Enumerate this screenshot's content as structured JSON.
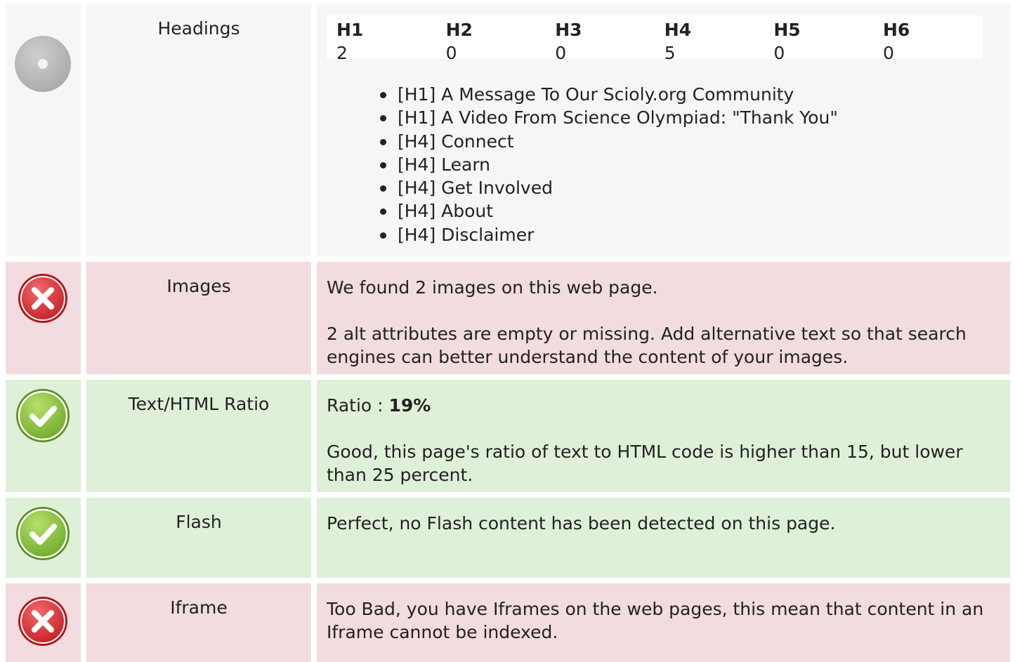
{
  "rows": {
    "headings": {
      "label": "Headings",
      "status": "neutral",
      "icon": "neutral-disc-icon",
      "table": [
        {
          "name": "H1",
          "count": "2"
        },
        {
          "name": "H2",
          "count": "0"
        },
        {
          "name": "H3",
          "count": "0"
        },
        {
          "name": "H4",
          "count": "5"
        },
        {
          "name": "H5",
          "count": "0"
        },
        {
          "name": "H6",
          "count": "0"
        }
      ],
      "list": [
        "[H1] A Message To Our Scioly.org Community",
        "[H1] A Video From Science Olympiad: \"Thank You\"",
        "[H4] Connect",
        "[H4] Learn",
        "[H4] Get Involved",
        "[H4] About",
        "[H4] Disclaimer"
      ]
    },
    "images": {
      "label": "Images",
      "status": "error",
      "icon": "error-x-icon",
      "para1": "We found 2 images on this web page.",
      "para2": "2 alt attributes are empty or missing. Add alternative text so that search engines can better understand the content of your images."
    },
    "ratio": {
      "label": "Text/HTML Ratio",
      "status": "ok",
      "icon": "check-icon",
      "ratio_prefix": "Ratio : ",
      "ratio_value": "19%",
      "para2": "Good, this page's ratio of text to HTML code is higher than 15, but lower than 25 percent."
    },
    "flash": {
      "label": "Flash",
      "status": "ok",
      "icon": "check-icon",
      "para1": "Perfect, no Flash content has been detected on this page."
    },
    "iframe": {
      "label": "Iframe",
      "status": "error",
      "icon": "error-x-icon",
      "para1": "Too Bad, you have Iframes on the web pages, this mean that content in an Iframe cannot be indexed."
    }
  },
  "colors": {
    "neutral_bg": "#f6f6f6",
    "error_bg": "#f2dcdf",
    "ok_bg": "#dff0d8",
    "error_icon": "#d9262c",
    "ok_icon": "#8cc63f",
    "neutral_icon": "#b8b8b8"
  }
}
